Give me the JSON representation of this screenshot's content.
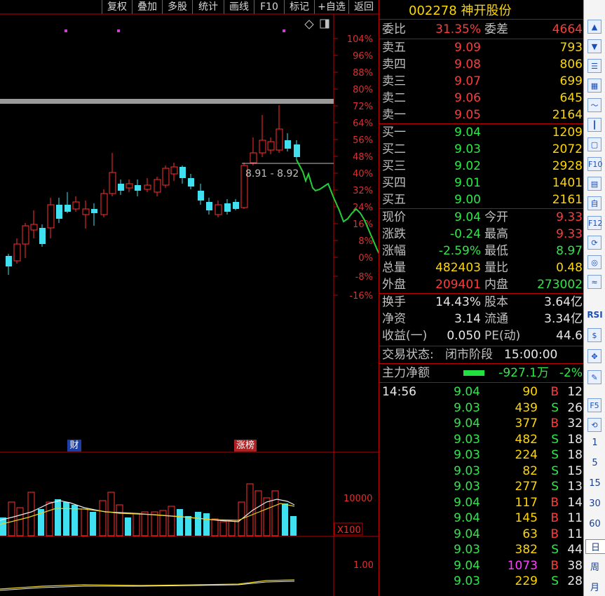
{
  "toolbar": {
    "items": [
      "复权",
      "叠加",
      "多股",
      "统计",
      "画线",
      "F10",
      "标记",
      "+自选",
      "返回"
    ]
  },
  "chart": {
    "y_axis_ticks": [
      "104%",
      "96%",
      "88%",
      "80%",
      "72%",
      "64%",
      "56%",
      "48%",
      "40%",
      "32%",
      "24%",
      "16%",
      "8%",
      "0%",
      "-8%",
      "-16%"
    ],
    "range_label": "8.91 - 8.92",
    "markers": [
      "财",
      "涨榜"
    ],
    "volume_tick": "10000",
    "volume_unit": "X100",
    "indicator_tick": "1.00"
  },
  "stock": {
    "code": "002278",
    "name": "神开股份"
  },
  "order_book": {
    "weibi_label": "委比",
    "weibi_value": "31.35%",
    "weicha_label": "委差",
    "weicha_value": "4664",
    "sells": [
      {
        "label": "卖五",
        "price": "9.09",
        "vol": "793"
      },
      {
        "label": "卖四",
        "price": "9.08",
        "vol": "806"
      },
      {
        "label": "卖三",
        "price": "9.07",
        "vol": "699"
      },
      {
        "label": "卖二",
        "price": "9.06",
        "vol": "645"
      },
      {
        "label": "卖一",
        "price": "9.05",
        "vol": "2164"
      }
    ],
    "buys": [
      {
        "label": "买一",
        "price": "9.04",
        "vol": "1209"
      },
      {
        "label": "买二",
        "price": "9.03",
        "vol": "2072"
      },
      {
        "label": "买三",
        "price": "9.02",
        "vol": "2928"
      },
      {
        "label": "买四",
        "price": "9.01",
        "vol": "1401"
      },
      {
        "label": "买五",
        "price": "9.00",
        "vol": "2161"
      }
    ]
  },
  "quote": [
    {
      "l1": "现价",
      "v1": "9.04",
      "l2": "今开",
      "v2": "9.33"
    },
    {
      "l1": "涨跌",
      "v1": "-0.24",
      "l2": "最高",
      "v2": "9.33"
    },
    {
      "l1": "涨幅",
      "v1": "-2.59%",
      "l2": "最低",
      "v2": "8.97"
    },
    {
      "l1": "总量",
      "v1": "482403",
      "l2": "量比",
      "v2": "0.48"
    },
    {
      "l1": "外盘",
      "v1": "209401",
      "l2": "内盘",
      "v2": "273002"
    }
  ],
  "fundamentals": [
    {
      "l1": "换手",
      "v1": "14.43%",
      "l2": "股本",
      "v2": "3.64亿"
    },
    {
      "l1": "净资",
      "v1": "3.14",
      "l2": "流通",
      "v2": "3.34亿"
    },
    {
      "l1": "收益(一)",
      "v1": "0.050",
      "l2": "PE(动)",
      "v2": "44.6"
    }
  ],
  "trade_status": {
    "label": "交易状态:",
    "state": "闭市阶段",
    "time": "15:00:00"
  },
  "main_flow": {
    "label": "主力净额",
    "amount": "-927.1万",
    "pct": "-2%"
  },
  "ticks": [
    {
      "time": "14:56",
      "price": "9.04",
      "vol": "90",
      "side": "B",
      "n": "12"
    },
    {
      "time": "",
      "price": "9.03",
      "vol": "439",
      "side": "S",
      "n": "26"
    },
    {
      "time": "",
      "price": "9.04",
      "vol": "377",
      "side": "B",
      "n": "32"
    },
    {
      "time": "",
      "price": "9.03",
      "vol": "482",
      "side": "S",
      "n": "18"
    },
    {
      "time": "",
      "price": "9.03",
      "vol": "224",
      "side": "S",
      "n": "18"
    },
    {
      "time": "",
      "price": "9.03",
      "vol": "82",
      "side": "S",
      "n": "15"
    },
    {
      "time": "",
      "price": "9.03",
      "vol": "277",
      "side": "S",
      "n": "13"
    },
    {
      "time": "",
      "price": "9.04",
      "vol": "117",
      "side": "B",
      "n": "14"
    },
    {
      "time": "",
      "price": "9.04",
      "vol": "145",
      "side": "B",
      "n": "11"
    },
    {
      "time": "",
      "price": "9.04",
      "vol": "63",
      "side": "B",
      "n": "11"
    },
    {
      "time": "",
      "price": "9.03",
      "vol": "382",
      "side": "S",
      "n": "44"
    },
    {
      "time": "",
      "price": "9.04",
      "vol": "1073",
      "side": "B",
      "n": "38"
    },
    {
      "time": "",
      "price": "9.03",
      "vol": "229",
      "side": "S",
      "n": "28"
    }
  ],
  "side_toolbar": {
    "icons": [
      "chevron-up-icon",
      "chevron-down-icon",
      "list-icon",
      "table-icon",
      "line-chart-icon",
      "candle-icon",
      "window-icon",
      "f10-icon",
      "book-icon",
      "self-icon",
      "f12-icon",
      "clock-icon",
      "refresh-icon",
      "wave-icon"
    ],
    "rsi": "RSI",
    "periods": [
      "1",
      "5",
      "15",
      "30",
      "60",
      "日",
      "周",
      "月"
    ]
  }
}
